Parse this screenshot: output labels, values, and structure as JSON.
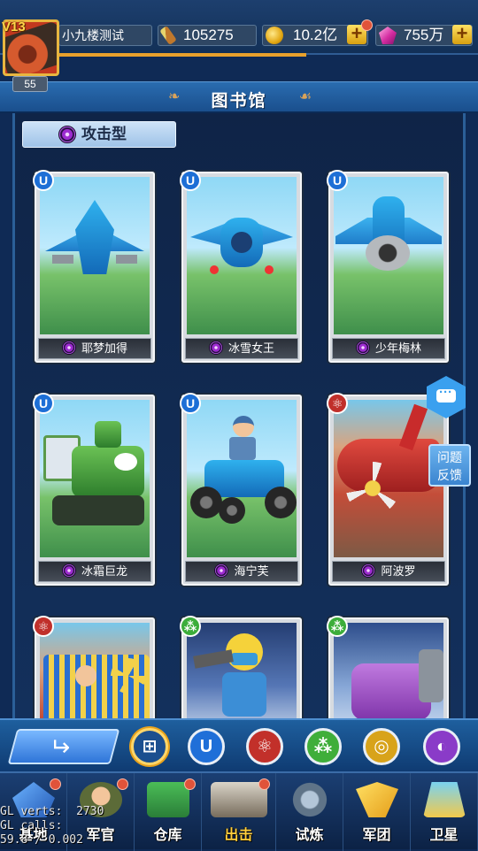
{
  "player": {
    "vip": "V13",
    "level": "55",
    "name": "小九楼测试",
    "xp": "105275",
    "gold": "10.2亿",
    "gems": "755万"
  },
  "header": {
    "title": "图书馆"
  },
  "category_tab": {
    "label": "攻击型"
  },
  "cards": [
    {
      "name": "耶梦加得",
      "type_icon": "magnet-icon"
    },
    {
      "name": "冰雪女王",
      "type_icon": "magnet-icon"
    },
    {
      "name": "少年梅林",
      "type_icon": "magnet-icon"
    },
    {
      "name": "冰霜巨龙",
      "type_icon": "magnet-icon"
    },
    {
      "name": "海宁芙",
      "type_icon": "magnet-icon"
    },
    {
      "name": "阿波罗",
      "type_icon": "atom-icon"
    },
    {
      "name": "",
      "type_icon": "atom-icon"
    },
    {
      "name": "",
      "type_icon": "molecule-icon"
    },
    {
      "name": "",
      "type_icon": "molecule-icon"
    }
  ],
  "side": {
    "feedback_label": "问题\n反馈"
  },
  "filter_bar": {
    "buttons": [
      "all-icon",
      "magnet-icon",
      "atom-icon",
      "molecule-icon",
      "ring-icon",
      "half-circle-icon"
    ]
  },
  "bottom_nav": [
    {
      "label": "基地"
    },
    {
      "label": "军官"
    },
    {
      "label": "仓库"
    },
    {
      "label": "出击"
    },
    {
      "label": "试炼"
    },
    {
      "label": "军团"
    },
    {
      "label": "卫星"
    }
  ],
  "debug_overlay": {
    "line1": "GL verts:  2730",
    "line2": "GL calls:    ",
    "line3": "59.8 / 0.002"
  },
  "colors": {
    "accent_gold": "#e8b640",
    "badge_red": "#e0533a",
    "panel_blue": "#1a4f8d"
  }
}
